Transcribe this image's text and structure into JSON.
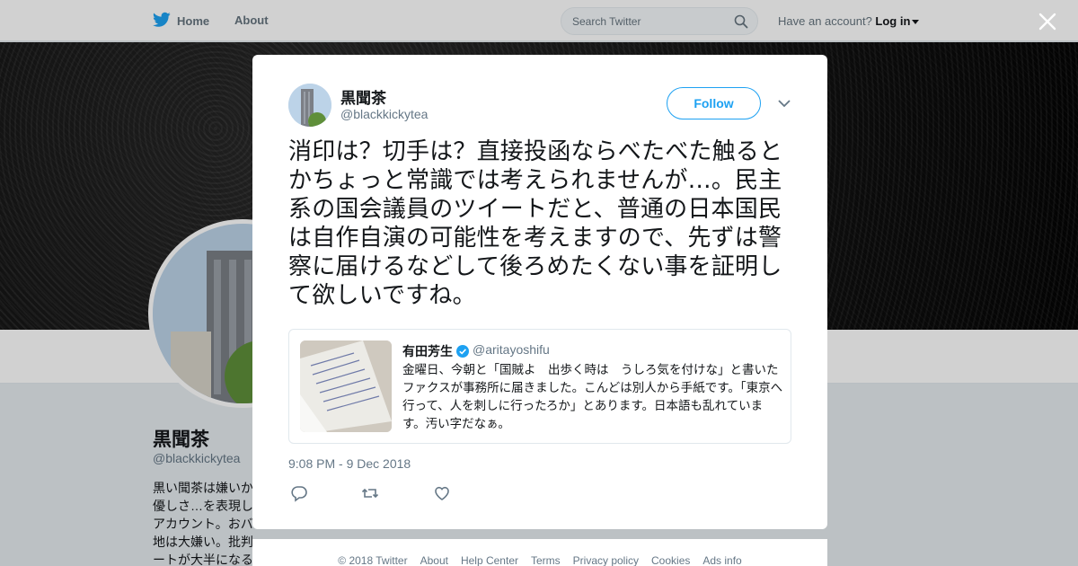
{
  "topbar": {
    "home_label": "Home",
    "about_label": "About",
    "search_placeholder": "Search Twitter",
    "account_prompt": "Have an account?",
    "login_label": "Log in"
  },
  "profile": {
    "name": "黒聞茶",
    "handle": "@blackkickytea",
    "bio_lines": [
      "黒い聞茶は嫌いか",
      "優しさ…を表現し",
      "アカウント。おバ",
      "地は大嫌い。批判",
      "ートが大半になる"
    ]
  },
  "tweet": {
    "author_name": "黒聞茶",
    "author_handle": "@blackkickytea",
    "follow_label": "Follow",
    "text": "消印は？切手は？直接投函ならべたべた触るとかちょっと常識では考えられませんが…。民主系の国会議員のツイートだと、普通の日本国民は自作自演の可能性を考えますので、先ずは警察に届けるなどして後ろめたくない事を証明して欲しいですね。",
    "timestamp": "9:08 PM - 9 Dec 2018",
    "quoted": {
      "name": "有田芳生",
      "handle": "@aritayoshifu",
      "text": "金曜日、今朝と「国賊よ　出歩く時は　うしろ気を付けな」と書いたファクスが事務所に届きました。こんどは別人から手紙です。「東京へ行って、人を刺しに行ったろか」とあります。日本語も乱れています。汚い字だなぁ。"
    }
  },
  "footer": {
    "links": [
      "© 2018 Twitter",
      "About",
      "Help Center",
      "Terms",
      "Privacy policy",
      "Cookies",
      "Ads info"
    ]
  },
  "colors": {
    "brand": "#1da1f2",
    "text": "#14171a",
    "secondary": "#657786"
  }
}
